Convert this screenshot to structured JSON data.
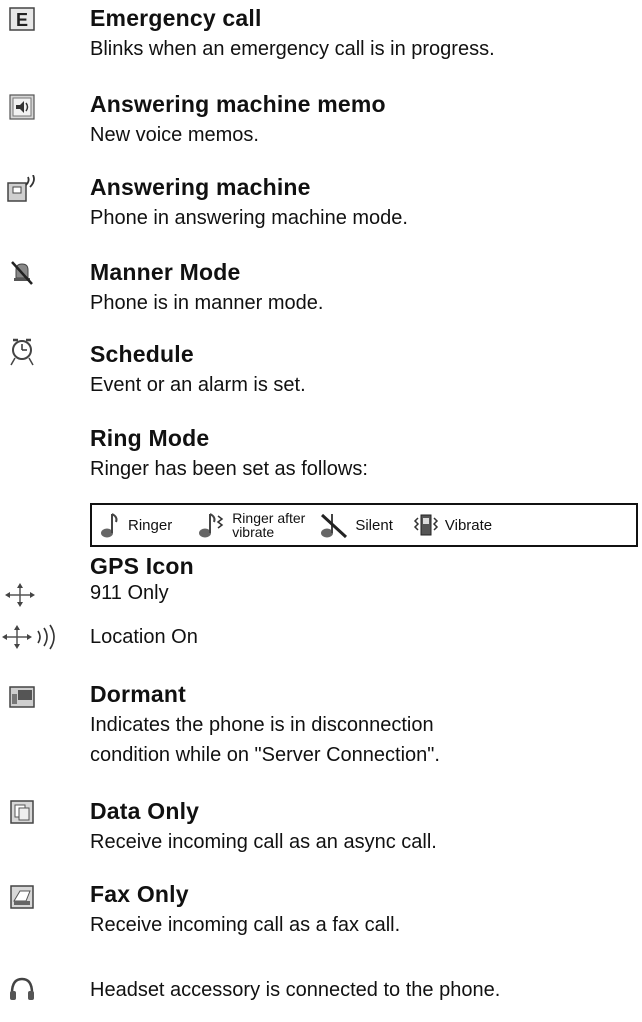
{
  "entries": {
    "emergency": {
      "title": "Emergency call",
      "desc": "Blinks when an emergency call is in progress.",
      "icon": "emergency-e-icon"
    },
    "memo": {
      "title": "Answering machine memo",
      "desc": "New voice memos.",
      "icon": "voice-memo-icon"
    },
    "answering": {
      "title": "Answering machine",
      "desc": "Phone in answering machine mode.",
      "icon": "answering-machine-icon"
    },
    "manner": {
      "title": "Manner Mode",
      "desc": "Phone is in manner mode.",
      "icon": "manner-mode-icon"
    },
    "schedule": {
      "title": "Schedule",
      "desc": "Event or an alarm is set.",
      "icon": "alarm-clock-icon"
    },
    "ring": {
      "title": "Ring Mode",
      "desc": "Ringer has been set as follows:"
    },
    "gps": {
      "title": "GPS Icon",
      "option1": "911 Only",
      "option2": "Location On",
      "icon1": "gps-911-icon",
      "icon2": "gps-location-on-icon"
    },
    "dormant": {
      "title": "Dormant",
      "desc_line1": "Indicates the phone is in disconnection",
      "desc_line2": "condition while on \"Server Connection\".",
      "icon": "dormant-icon"
    },
    "data_only": {
      "title": "Data Only",
      "desc": "Receive incoming call as an async call.",
      "icon": "data-only-icon"
    },
    "fax_only": {
      "title": "Fax Only",
      "desc": "Receive incoming call as a fax call.",
      "icon": "fax-only-icon"
    },
    "headset": {
      "desc": "Headset accessory is connected to the phone.",
      "icon": "headset-icon"
    }
  },
  "ring_modes": {
    "ringer": "Ringer",
    "ringer_after_line1": "Ringer after",
    "ringer_after_line2": "vibrate",
    "silent": "Silent",
    "vibrate": "Vibrate"
  }
}
